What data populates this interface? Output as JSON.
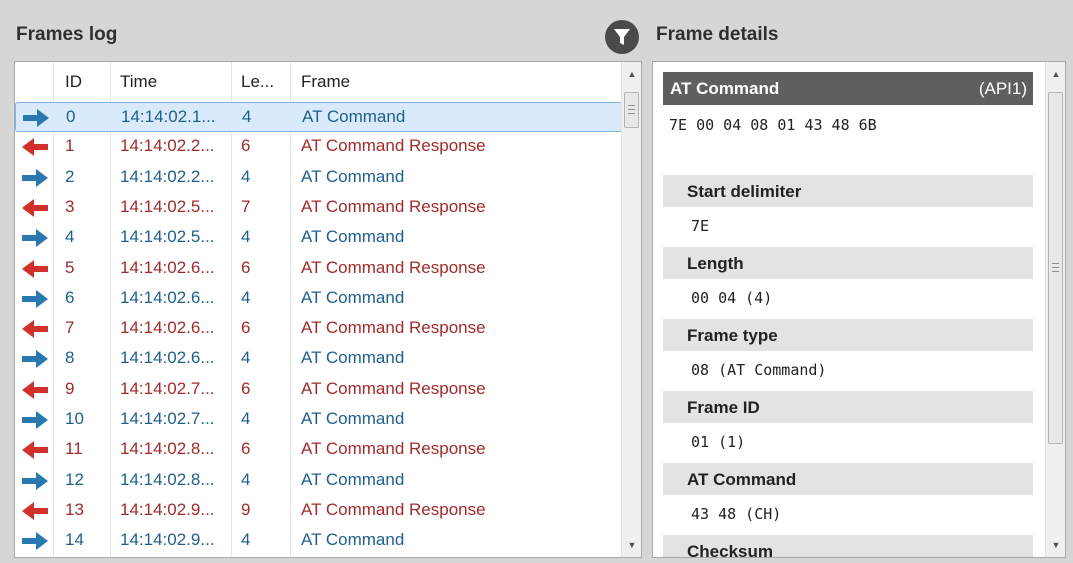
{
  "frames_log": {
    "title": "Frames log",
    "columns": [
      "ID",
      "Time",
      "Le...",
      "Frame"
    ],
    "rows": [
      {
        "id": "0",
        "time": "14:14:02.1...",
        "len": "4",
        "frame": "AT Command",
        "dir": "sent",
        "selected": true
      },
      {
        "id": "1",
        "time": "14:14:02.2...",
        "len": "6",
        "frame": "AT Command Response",
        "dir": "recv"
      },
      {
        "id": "2",
        "time": "14:14:02.2...",
        "len": "4",
        "frame": "AT Command",
        "dir": "sent"
      },
      {
        "id": "3",
        "time": "14:14:02.5...",
        "len": "7",
        "frame": "AT Command Response",
        "dir": "recv"
      },
      {
        "id": "4",
        "time": "14:14:02.5...",
        "len": "4",
        "frame": "AT Command",
        "dir": "sent"
      },
      {
        "id": "5",
        "time": "14:14:02.6...",
        "len": "6",
        "frame": "AT Command Response",
        "dir": "recv"
      },
      {
        "id": "6",
        "time": "14:14:02.6...",
        "len": "4",
        "frame": "AT Command",
        "dir": "sent"
      },
      {
        "id": "7",
        "time": "14:14:02.6...",
        "len": "6",
        "frame": "AT Command Response",
        "dir": "recv"
      },
      {
        "id": "8",
        "time": "14:14:02.6...",
        "len": "4",
        "frame": "AT Command",
        "dir": "sent"
      },
      {
        "id": "9",
        "time": "14:14:02.7...",
        "len": "6",
        "frame": "AT Command Response",
        "dir": "recv"
      },
      {
        "id": "10",
        "time": "14:14:02.7...",
        "len": "4",
        "frame": "AT Command",
        "dir": "sent"
      },
      {
        "id": "11",
        "time": "14:14:02.8...",
        "len": "6",
        "frame": "AT Command Response",
        "dir": "recv"
      },
      {
        "id": "12",
        "time": "14:14:02.8...",
        "len": "4",
        "frame": "AT Command",
        "dir": "sent"
      },
      {
        "id": "13",
        "time": "14:14:02.9...",
        "len": "9",
        "frame": "AT Command Response",
        "dir": "recv"
      },
      {
        "id": "14",
        "time": "14:14:02.9...",
        "len": "4",
        "frame": "AT Command",
        "dir": "sent"
      }
    ]
  },
  "frame_details": {
    "title": "Frame details",
    "api_label": "AT Command",
    "api_mode": "(API1)",
    "raw_hex": "7E 00 04 08 01 43 48 6B",
    "fields": [
      {
        "label": "Start delimiter",
        "value": "7E"
      },
      {
        "label": "Length",
        "value": "00 04 (4)"
      },
      {
        "label": "Frame type",
        "value": "08 (AT Command)"
      },
      {
        "label": "Frame ID",
        "value": "01 (1)"
      },
      {
        "label": "AT Command",
        "value": "43 48 (CH)"
      },
      {
        "label": "Checksum",
        "value": ""
      }
    ]
  },
  "icons": {
    "filter": "filter-icon",
    "sent": "arrow-right-icon",
    "received": "arrow-left-icon"
  },
  "colors": {
    "sent": "#1e5f8d",
    "received": "#a12b2b",
    "sent_arrow": "#2a78b0",
    "received_arrow": "#d0312d",
    "selected_row": "#d9ebfb"
  }
}
